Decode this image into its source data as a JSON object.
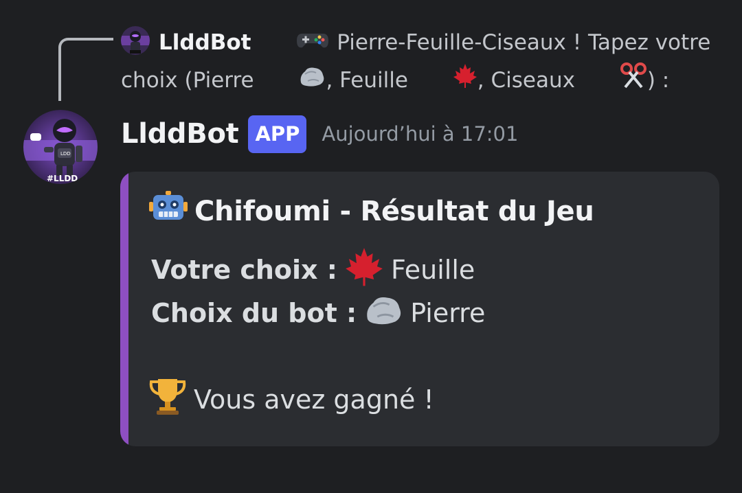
{
  "reply": {
    "author": "LlddBot",
    "text_before": "Pierre-Feuille-Ciseaux ! Tapez votre choix (Pierre ",
    "text_mid1": ", Feuille ",
    "text_mid2": ", Ciseaux ",
    "text_end": ") :"
  },
  "message": {
    "author": "LlddBot",
    "badge": "APP",
    "timestamp": "Aujourd’hui à 17:01"
  },
  "embed": {
    "accent_color": "#8e4fc2",
    "title": "Chifoumi - Résultat du Jeu",
    "user_choice_label": "Votre choix :",
    "user_choice_value": "Feuille",
    "bot_choice_label": "Choix du bot :",
    "bot_choice_value": "Pierre",
    "result": "Vous avez gagné !"
  },
  "icons": {
    "reply_game": "video-game-icon",
    "rock": "rock-icon",
    "leaf": "maple-leaf-icon",
    "scissors": "scissors-icon",
    "title": "robot-icon",
    "result": "trophy-icon"
  }
}
